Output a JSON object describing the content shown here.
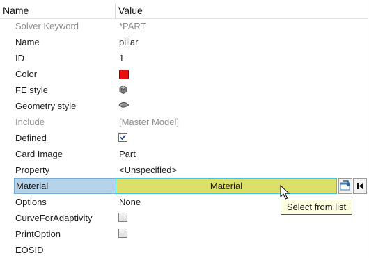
{
  "header": {
    "name_label": "Name",
    "value_label": "Value"
  },
  "rows": [
    {
      "name": "Solver Keyword",
      "value": "*PART"
    },
    {
      "name": "Name",
      "value": "pillar"
    },
    {
      "name": "ID",
      "value": "1"
    },
    {
      "name": "Color",
      "value": "",
      "swatch_color": "#e8100e"
    },
    {
      "name": "FE style",
      "value": "",
      "icon": "fe-style-shaded-cube-icon"
    },
    {
      "name": "Geometry style",
      "value": "",
      "icon": "geometry-style-shaded-icon"
    },
    {
      "name": "Include",
      "value": "[Master Model]"
    },
    {
      "name": "Defined",
      "value": "",
      "checked": true
    },
    {
      "name": "Card Image",
      "value": "Part"
    },
    {
      "name": "Property",
      "value": "<Unspecified>"
    },
    {
      "name": "Material",
      "value": "Material"
    },
    {
      "name": "Options",
      "value": "None"
    },
    {
      "name": "CurveForAdaptivity",
      "value": "",
      "checked": false
    },
    {
      "name": "PrintOption",
      "value": "",
      "checked": false
    },
    {
      "name": "EOSID",
      "value": ""
    }
  ],
  "material_buttons": {
    "select_icon": "select-from-list-icon",
    "first_icon": "go-to-first-icon"
  },
  "tooltip": {
    "text": "Select from list"
  }
}
